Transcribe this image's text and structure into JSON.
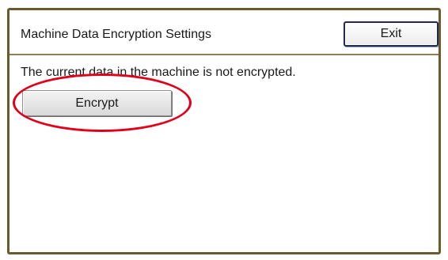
{
  "window": {
    "title": "Machine Data Encryption Settings",
    "exit_label": "Exit"
  },
  "main": {
    "status_message": "The current data in the machine is not encrypted.",
    "encrypt_label": "Encrypt"
  },
  "colors": {
    "frame_border": "#6a5a2e",
    "exit_border": "#1f2a55",
    "highlight": "#e0001a"
  }
}
